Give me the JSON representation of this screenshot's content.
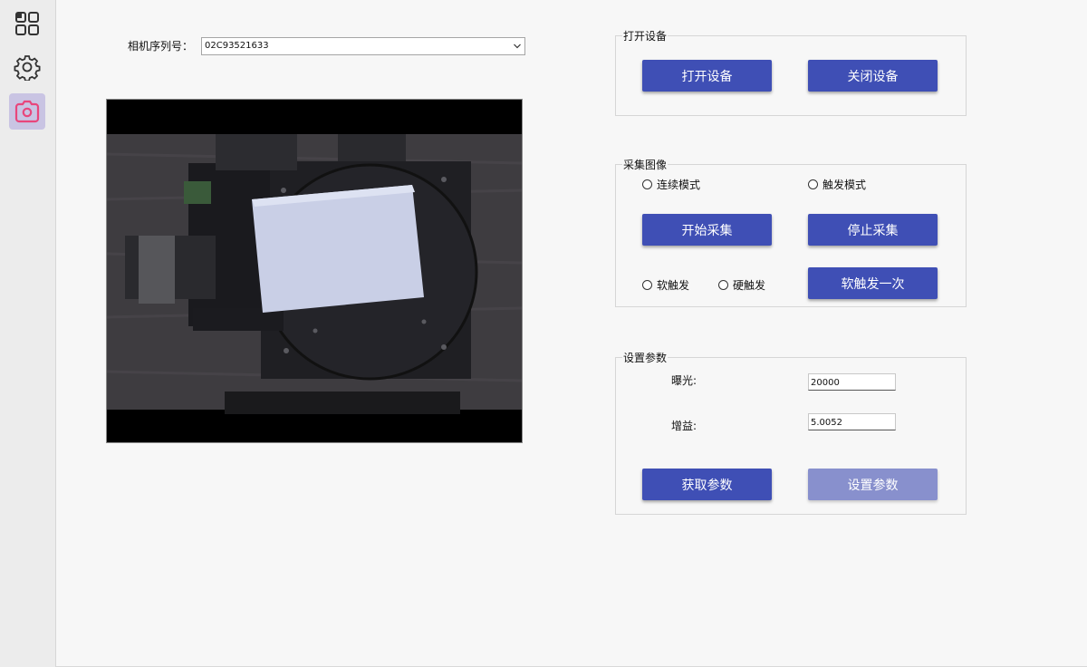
{
  "sidebar": {
    "items": [
      {
        "name": "dashboard-icon"
      },
      {
        "name": "gear-icon"
      },
      {
        "name": "camera-icon",
        "active": true
      }
    ],
    "accent": "#e8467c"
  },
  "camera": {
    "serial_label": "相机序列号：",
    "serial_value": "02C93521633"
  },
  "device_group": {
    "title": "打开设备",
    "open_label": "打开设备",
    "close_label": "关闭设备"
  },
  "capture_group": {
    "title": "采集图像",
    "continuous_mode_label": "连续模式",
    "trigger_mode_label": "触发模式",
    "start_label": "开始采集",
    "stop_label": "停止采集",
    "soft_trigger_label": "软触发",
    "hard_trigger_label": "硬触发",
    "soft_trigger_once_label": "软触发一次"
  },
  "params_group": {
    "title": "设置参数",
    "exposure_label": "曝光:",
    "exposure_value": "20000",
    "gain_label": "增益:",
    "gain_value": "5.0052",
    "get_label": "获取参数",
    "set_label": "设置参数"
  },
  "colors": {
    "button": "#3f4fb5",
    "button_disabled": "#8890cd",
    "active_nav": "#c9c4e3"
  }
}
